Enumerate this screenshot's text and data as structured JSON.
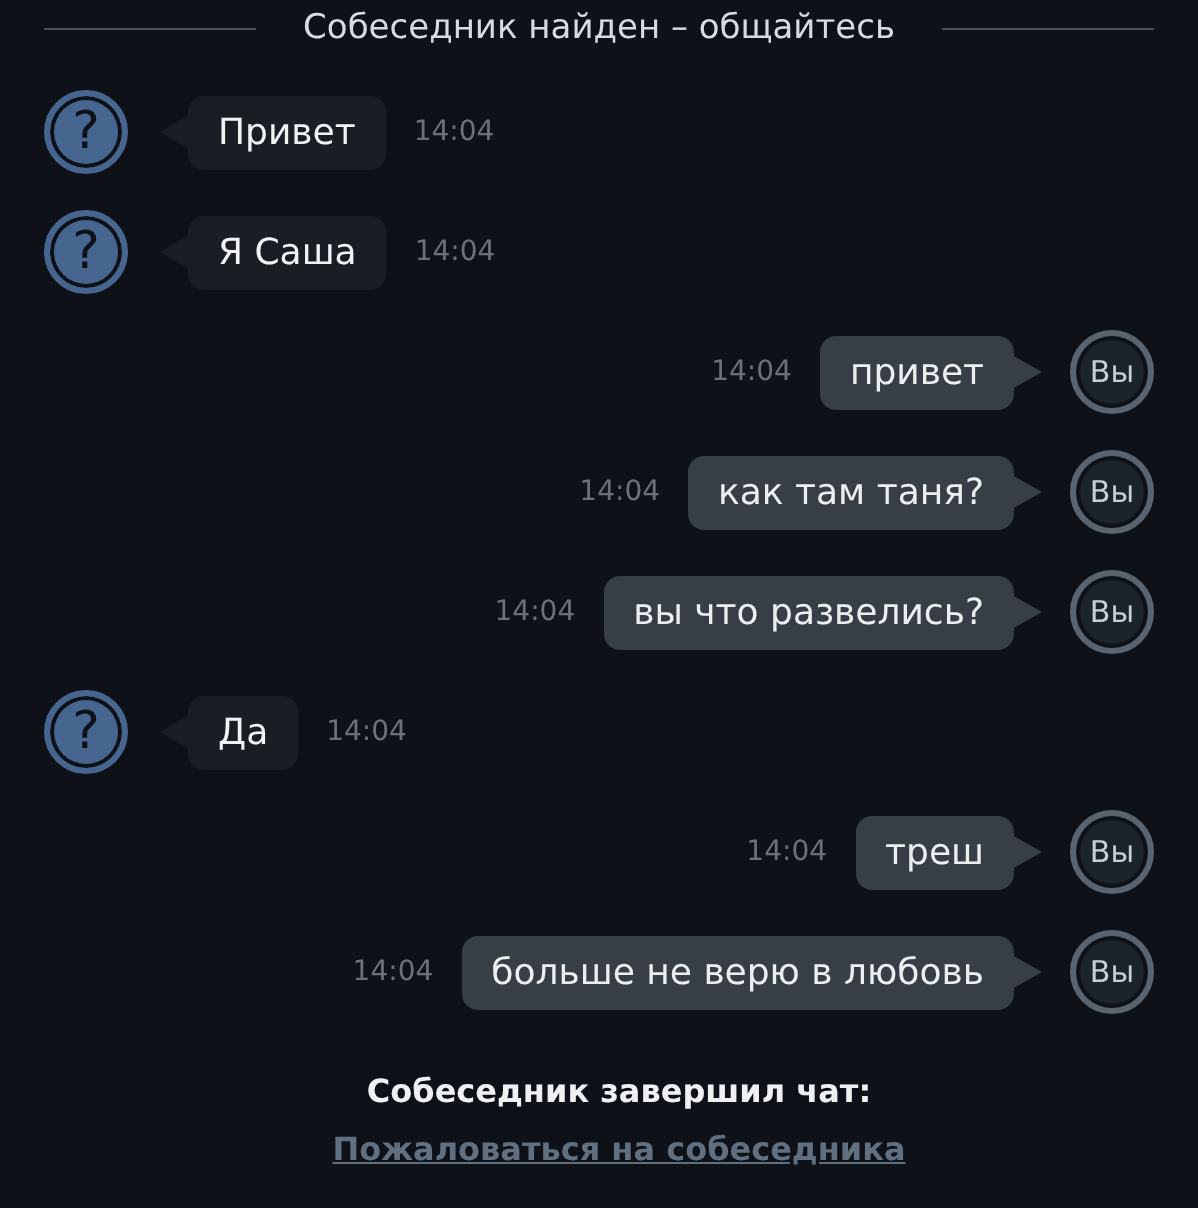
{
  "header": {
    "title": "Собеседник найден – общайтесь"
  },
  "messages": [
    {
      "kind": "incoming",
      "avatar": "?",
      "text": "Привет",
      "time": "14:04"
    },
    {
      "kind": "incoming",
      "avatar": "?",
      "text": "Я Саша",
      "time": "14:04"
    },
    {
      "kind": "outgoing",
      "avatar": "Вы",
      "text": "привет",
      "time": "14:04"
    },
    {
      "kind": "outgoing",
      "avatar": "Вы",
      "text": "как там таня?",
      "time": "14:04"
    },
    {
      "kind": "outgoing",
      "avatar": "Вы",
      "text": "вы что развелись?",
      "time": "14:04"
    },
    {
      "kind": "incoming",
      "avatar": "?",
      "text": "Да",
      "time": "14:04"
    },
    {
      "kind": "outgoing",
      "avatar": "Вы",
      "text": "треш",
      "time": "14:04"
    },
    {
      "kind": "outgoing",
      "avatar": "Вы",
      "text": "больше не верю в любовь",
      "time": "14:04"
    }
  ],
  "footer": {
    "status": "Собеседник завершил чат:",
    "link": "Пожаловаться на собеседника"
  }
}
